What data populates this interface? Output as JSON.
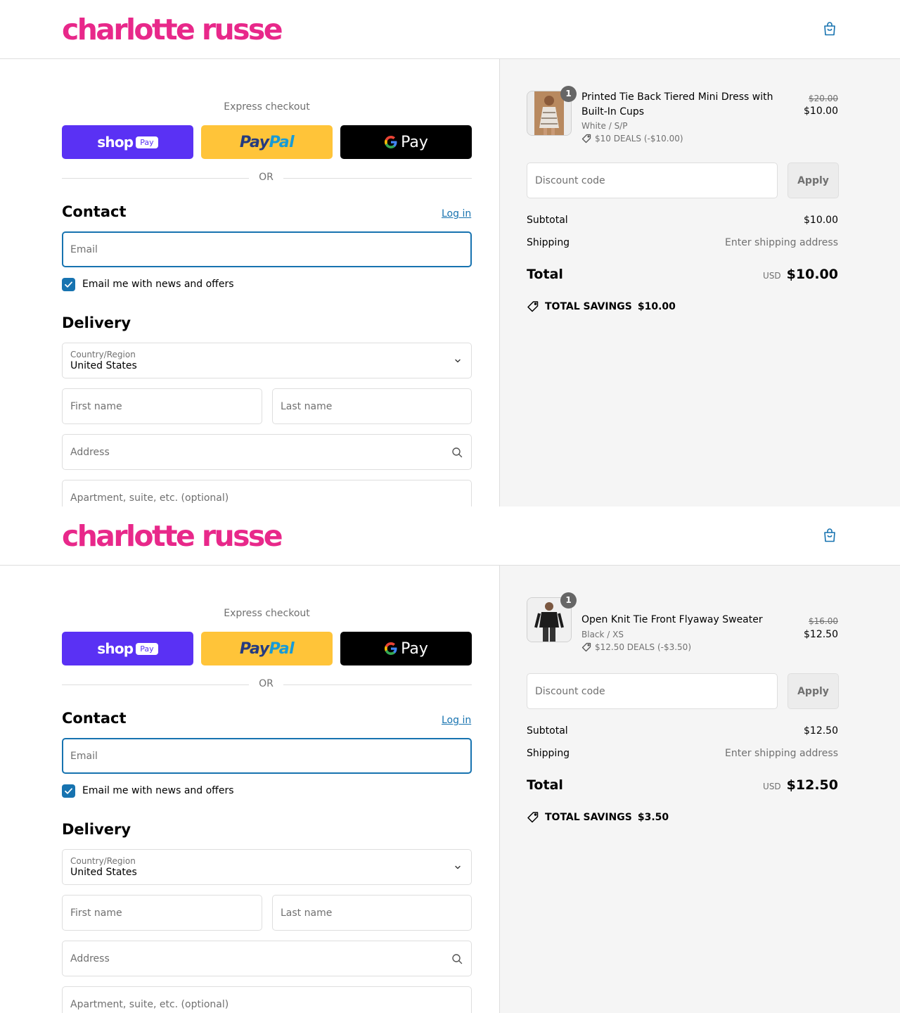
{
  "screens": [
    {
      "brand": "charlotte russe",
      "express_checkout_label": "Express checkout",
      "shop_pay": {
        "word": "shop",
        "pill": "Pay"
      },
      "paypal": {
        "part1": "Pay",
        "part2": "Pal"
      },
      "gpay": {
        "word": "Pay"
      },
      "or_label": "OR",
      "contact": {
        "title": "Contact",
        "login_label": "Log in",
        "email_placeholder": "Email"
      },
      "newsletter": {
        "label": "Email me with news and offers",
        "checked": true
      },
      "delivery": {
        "title": "Delivery",
        "country_label": "Country/Region",
        "country_value": "United States",
        "first_name_placeholder": "First name",
        "last_name_placeholder": "Last name",
        "address_placeholder": "Address",
        "apartment_placeholder": "Apartment, suite, etc. (optional)"
      },
      "cart": {
        "quantity": "1",
        "product_title": "Printed Tie Back Tiered Mini Dress with Built-In Cups",
        "variant": "White / S/P",
        "deal": "$10 DEALS (-$10.00)",
        "price_original": "$20.00",
        "price_current": "$10.00"
      },
      "discount": {
        "placeholder": "Discount code",
        "apply_label": "Apply"
      },
      "summary": {
        "subtotal_label": "Subtotal",
        "subtotal_value": "$10.00",
        "shipping_label": "Shipping",
        "shipping_value": "Enter shipping address",
        "total_label": "Total",
        "currency": "USD",
        "total_value": "$10.00",
        "savings_label": "TOTAL SAVINGS",
        "savings_value": "$10.00"
      }
    },
    {
      "brand": "charlotte russe",
      "express_checkout_label": "Express checkout",
      "shop_pay": {
        "word": "shop",
        "pill": "Pay"
      },
      "paypal": {
        "part1": "Pay",
        "part2": "Pal"
      },
      "gpay": {
        "word": "Pay"
      },
      "or_label": "OR",
      "contact": {
        "title": "Contact",
        "login_label": "Log in",
        "email_placeholder": "Email"
      },
      "newsletter": {
        "label": "Email me with news and offers",
        "checked": true
      },
      "delivery": {
        "title": "Delivery",
        "country_label": "Country/Region",
        "country_value": "United States",
        "first_name_placeholder": "First name",
        "last_name_placeholder": "Last name",
        "address_placeholder": "Address",
        "apartment_placeholder": "Apartment, suite, etc. (optional)"
      },
      "cart": {
        "quantity": "1",
        "product_title": "Open Knit Tie Front Flyaway Sweater",
        "variant": "Black / XS",
        "deal": "$12.50 DEALS (-$3.50)",
        "price_original": "$16.00",
        "price_current": "$12.50"
      },
      "discount": {
        "placeholder": "Discount code",
        "apply_label": "Apply"
      },
      "summary": {
        "subtotal_label": "Subtotal",
        "subtotal_value": "$12.50",
        "shipping_label": "Shipping",
        "shipping_value": "Enter shipping address",
        "total_label": "Total",
        "currency": "USD",
        "total_value": "$12.50",
        "savings_label": "TOTAL SAVINGS",
        "savings_value": "$3.50"
      }
    }
  ],
  "colors": {
    "brand_pink": "#e8288a",
    "link_blue": "#1773b0",
    "shop_pay_purple": "#5a31f4",
    "paypal_yellow": "#ffc439",
    "gpay_black": "#000000",
    "sidebar_bg": "#f5f5f5"
  }
}
